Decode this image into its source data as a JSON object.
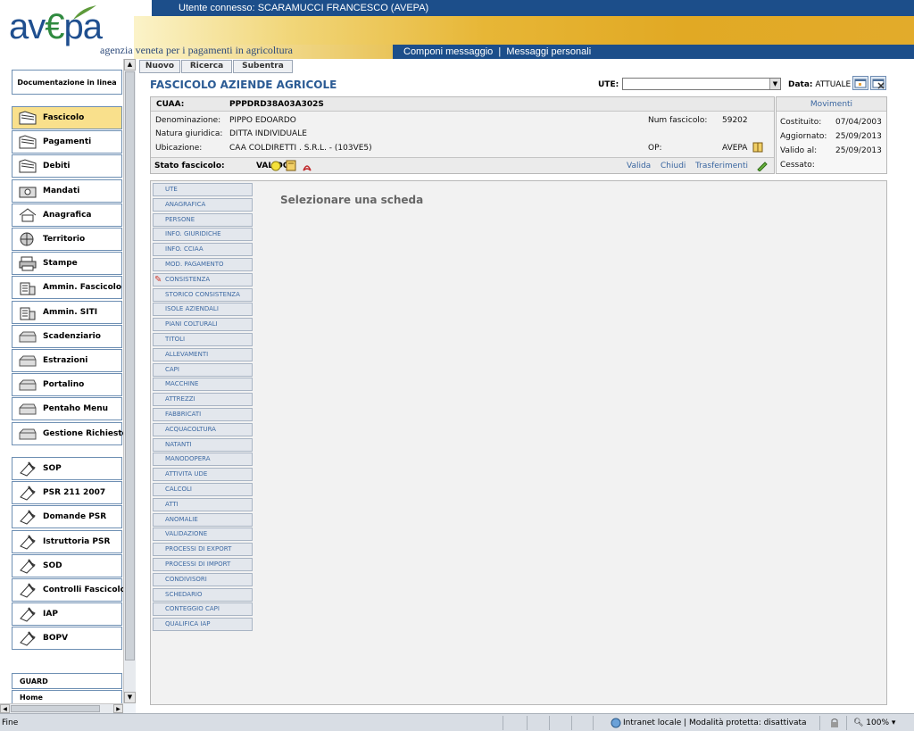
{
  "header": {
    "user_label": "Utente connesso:",
    "user_name": "SCARAMUCCI FRANCESCO (AVEPA)",
    "logo_text": "avepa",
    "logo_sub": "agenzia veneta per i pagamenti in agricoltura",
    "link_compose": "Componi messaggio",
    "link_sep": "|",
    "link_messages": "Messaggi personali"
  },
  "sidebar": {
    "doc_link": "Documentazione in linea",
    "group1": [
      {
        "label": "Fascicolo",
        "icon": "folder-icon",
        "active": true
      },
      {
        "label": "Pagamenti",
        "icon": "folder-icon"
      },
      {
        "label": "Debiti",
        "icon": "folder-icon"
      },
      {
        "label": "Mandati",
        "icon": "camera-icon"
      },
      {
        "label": "Anagrafica",
        "icon": "house-icon"
      },
      {
        "label": "Territorio",
        "icon": "globe-icon"
      },
      {
        "label": "Stampe",
        "icon": "printer-icon"
      },
      {
        "label": "Ammin. Fascicolo",
        "icon": "building-icon"
      },
      {
        "label": "Ammin. SITI",
        "icon": "building-icon"
      },
      {
        "label": "Scadenziario",
        "icon": "tray-icon"
      },
      {
        "label": "Estrazioni",
        "icon": "tray-icon"
      },
      {
        "label": "Portalino",
        "icon": "tray-icon"
      },
      {
        "label": "Pentaho Menu",
        "icon": "tray-icon"
      },
      {
        "label": "Gestione Richieste",
        "icon": "tray-icon"
      }
    ],
    "group2": [
      {
        "label": "SOP",
        "icon": "pen-paper-icon"
      },
      {
        "label": "PSR 211 2007",
        "icon": "pen-paper-icon"
      },
      {
        "label": "Domande PSR",
        "icon": "pen-paper-icon"
      },
      {
        "label": "Istruttoria PSR",
        "icon": "pen-paper-icon"
      },
      {
        "label": "SOD",
        "icon": "pen-paper-icon"
      },
      {
        "label": "Controlli Fascicolo",
        "icon": "pen-paper-icon"
      },
      {
        "label": "IAP",
        "icon": "pen-paper-icon"
      },
      {
        "label": "BOPV",
        "icon": "pen-paper-icon"
      }
    ],
    "guard": "GUARD",
    "home": "Home"
  },
  "toolbar": {
    "nuovo": "Nuovo",
    "ricerca": "Ricerca",
    "subentra": "Subentra"
  },
  "page": {
    "title": "FASCICOLO AZIENDE AGRICOLE",
    "ute_label": "UTE:",
    "ute_value": "",
    "data_label": "Data:",
    "data_value": "ATTUALE"
  },
  "fascicolo": {
    "cuaa_label": "CUAA:",
    "cuaa_value": "PPPDRD38A03A302S",
    "denominazione_label": "Denominazione:",
    "denominazione_value": "PIPPO EDOARDO",
    "natura_label": "Natura giuridica:",
    "natura_value": "DITTA INDIVIDUALE",
    "ubicazione_label": "Ubicazione:",
    "ubicazione_value": "CAA COLDIRETTI . S.R.L. - (103VE5)",
    "num_label": "Num fascicolo:",
    "num_value": "59202",
    "op_label": "OP:",
    "op_value": "AVEPA",
    "stato_label": "Stato fascicolo:",
    "stato_value": "VALIDO",
    "action_valida": "Valida",
    "action_chiudi": "Chiudi",
    "action_trasferimenti": "Trasferimenti"
  },
  "movimenti": {
    "title": "Movimenti",
    "rows": [
      {
        "label": "Costituito:",
        "value": "07/04/2003"
      },
      {
        "label": "Aggiornato:",
        "value": "25/09/2013"
      },
      {
        "label": "Valido al:",
        "value": "25/09/2013"
      },
      {
        "label": "Cessato:",
        "value": ""
      }
    ]
  },
  "tabs": [
    "UTE",
    "ANAGRAFICA",
    "PERSONE",
    "INFO. GIURIDICHE",
    "INFO. CCIAA",
    "MOD. PAGAMENTO",
    "CONSISTENZA",
    "STORICO CONSISTENZA",
    "ISOLE AZIENDALI",
    "PIANI COLTURALI",
    "TITOLI",
    "ALLEVAMENTI",
    "CAPI",
    "MACCHINE",
    "ATTREZZI",
    "FABBRICATI",
    "ACQUACOLTURA",
    "NATANTI",
    "MANODOPERA",
    "ATTIVITA UDE",
    "CALCOLI",
    "ATTI",
    "ANOMALIE",
    "VALIDAZIONE",
    "PROCESSI DI EXPORT",
    "PROCESSI DI IMPORT",
    "CONDIVISORI",
    "SCHEDARIO",
    "CONTEGGIO CAPI",
    "QUALIFICA IAP"
  ],
  "edited_tab": "CONSISTENZA",
  "select_message": "Selezionare una scheda",
  "statusbar": {
    "left": "Fine",
    "zone": "Intranet locale | Modalità protetta: disattivata",
    "zoom": "100%"
  },
  "colors": {
    "header_blue": "#1c4e8a",
    "active_nav": "#f9e08c",
    "title_blue": "#2b5b94"
  }
}
